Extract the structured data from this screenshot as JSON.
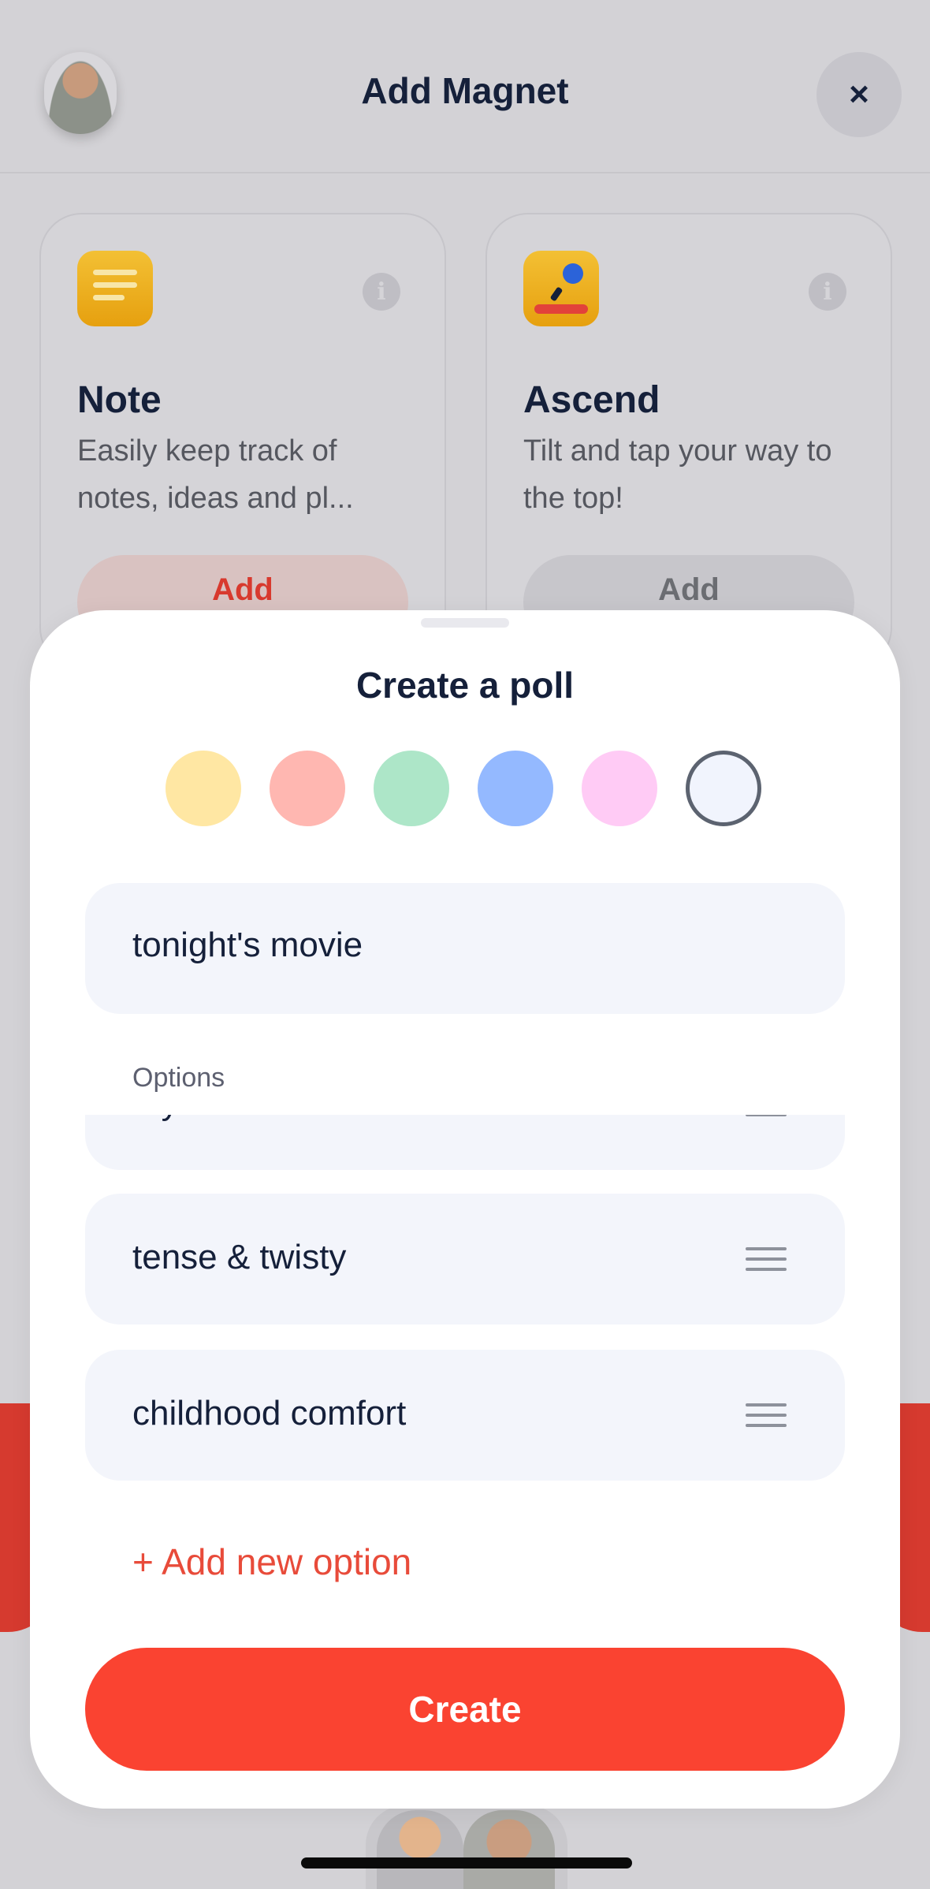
{
  "header": {
    "title": "Add Magnet",
    "close_label": "×"
  },
  "magnets": [
    {
      "title": "Note",
      "description": "Easily keep track of notes, ideas and pl...",
      "add_label": "Add",
      "info_label": "i",
      "icon": "note-icon",
      "color": "#F2B92A"
    },
    {
      "title": "Ascend",
      "description": "Tilt and tap your way to the top!",
      "add_label": "Add",
      "info_label": "i",
      "icon": "ascend-game-icon",
      "color": "#F2B92A"
    }
  ],
  "poll": {
    "title": "Create a poll",
    "colors": [
      "#FFE7A3",
      "#FFB7B1",
      "#ADE6C8",
      "#94B9FF",
      "#FFCBF5",
      "#F1F4FD"
    ],
    "selected_color_index": 5,
    "question_value": "tonight's movie",
    "options_label": "Options",
    "options": [
      "cry a little",
      "tense & twisty",
      "childhood comfort"
    ],
    "add_option_label": "+ Add new option",
    "create_label": "Create",
    "accent_color": "#FA4331"
  }
}
